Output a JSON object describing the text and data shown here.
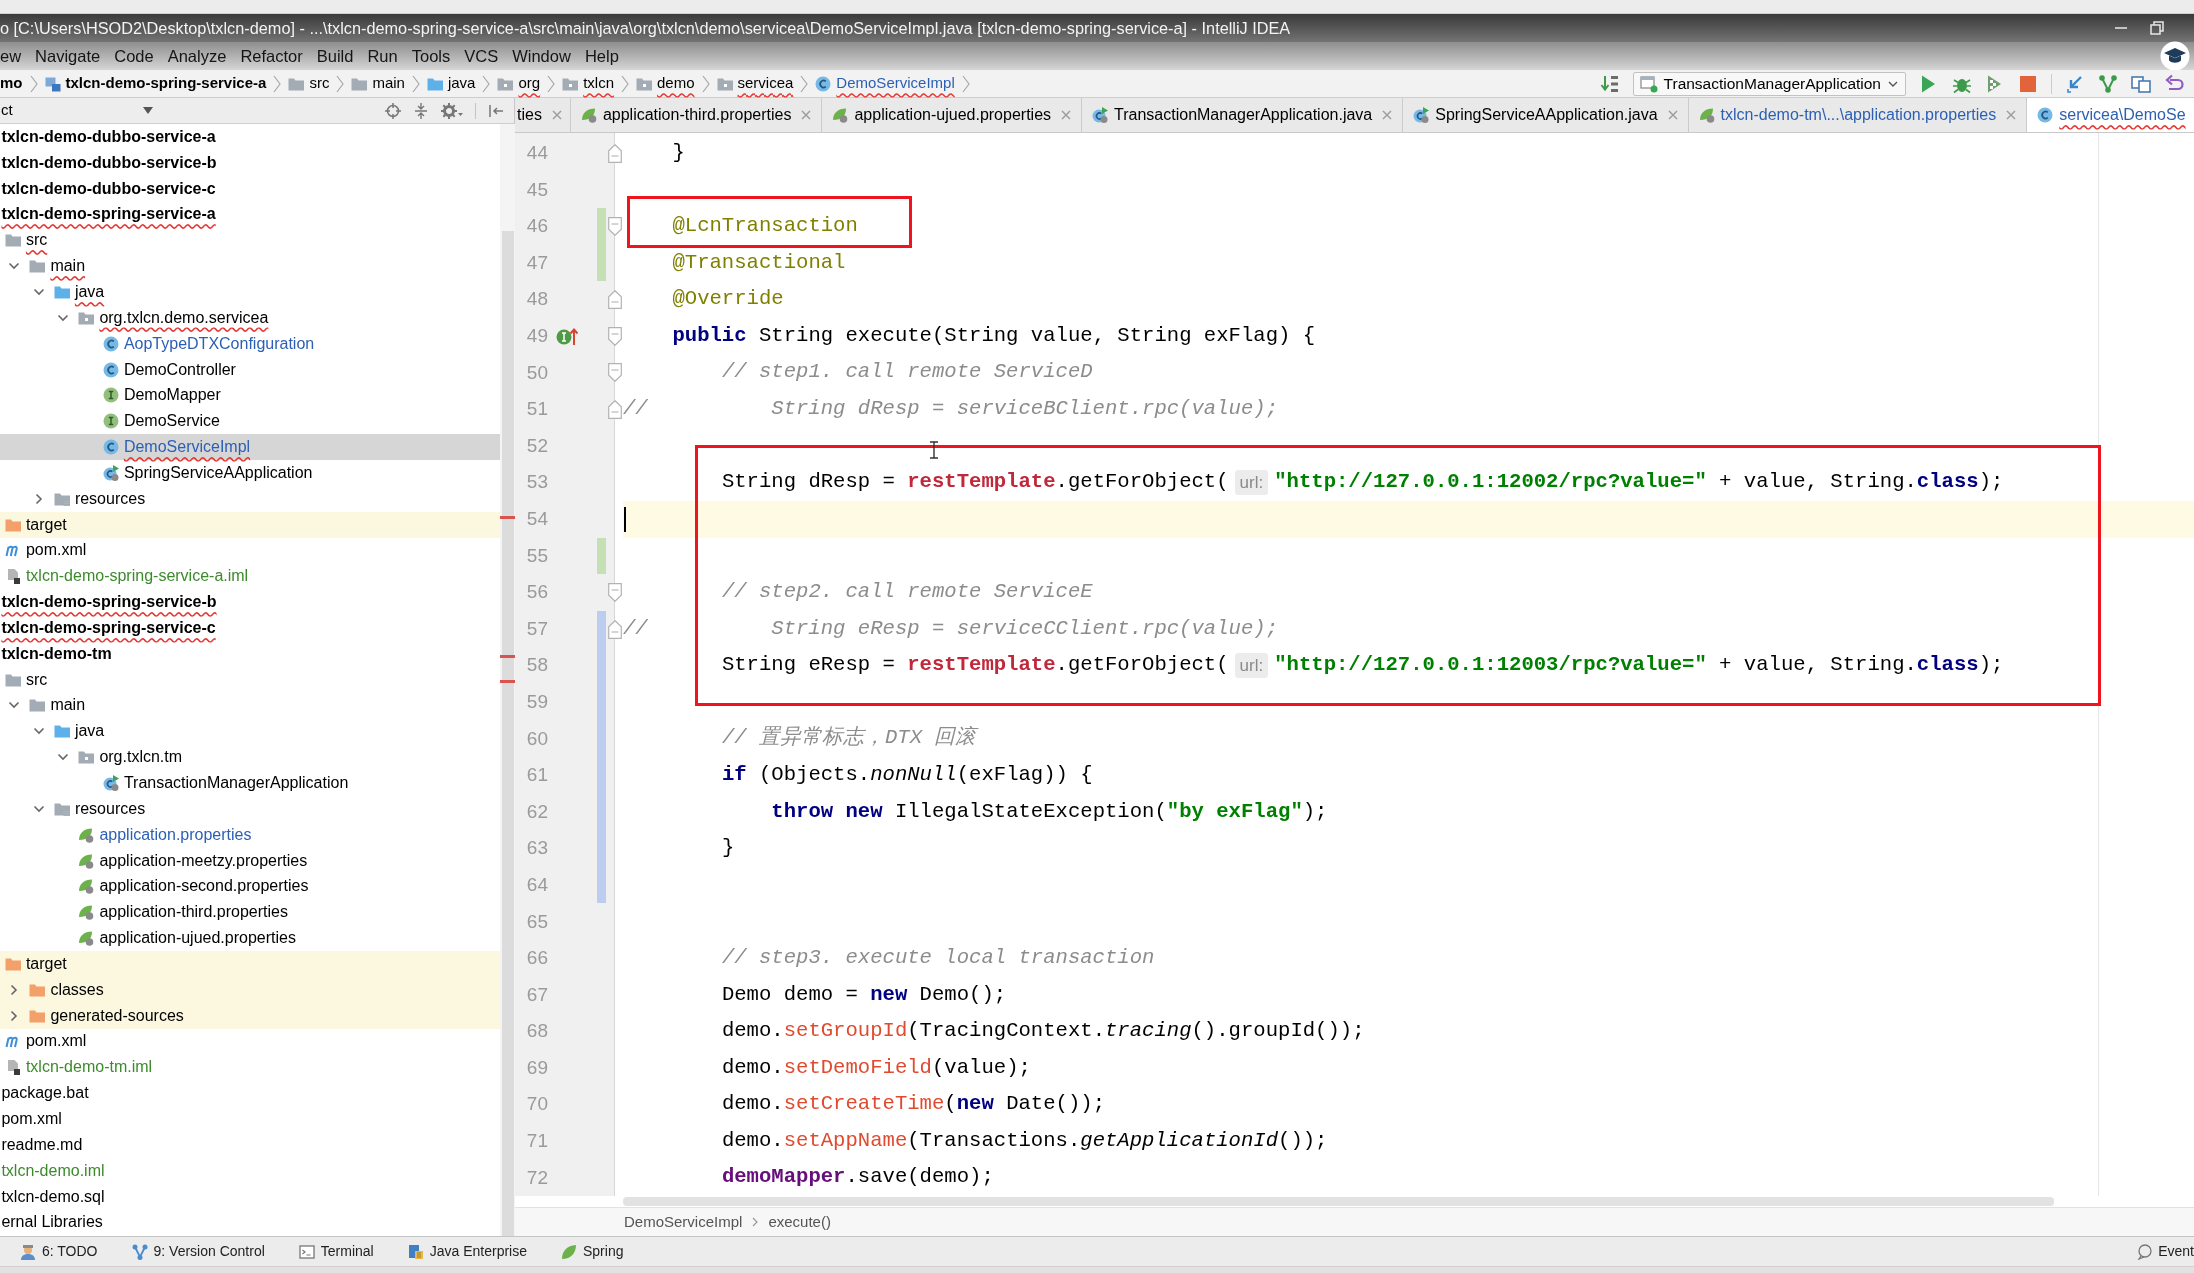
{
  "window": {
    "title": "o [C:\\Users\\HSOD2\\Desktop\\txlcn-demo] - ...\\txlcn-demo-spring-service-a\\src\\main\\java\\org\\txlcn\\demo\\servicea\\DemoServiceImpl.java [txlcn-demo-spring-service-a] - IntelliJ IDEA"
  },
  "menu": [
    "ew",
    "Navigate",
    "Code",
    "Analyze",
    "Refactor",
    "Build",
    "Run",
    "Tools",
    "VCS",
    "Window",
    "Help"
  ],
  "navigation": {
    "crumbs": [
      {
        "label": "mo",
        "kind": "project",
        "errors": false,
        "color": "#000000"
      },
      {
        "label": "txlcn-demo-spring-service-a",
        "kind": "module",
        "errors": false,
        "color": "#000000"
      },
      {
        "label": "src",
        "kind": "folder",
        "errors": false,
        "color": "#000000"
      },
      {
        "label": "main",
        "kind": "folder",
        "errors": false,
        "color": "#000000"
      },
      {
        "label": "java",
        "kind": "source-root",
        "errors": false,
        "color": "#000000"
      },
      {
        "label": "org",
        "kind": "package",
        "errors": true,
        "color": "#000000"
      },
      {
        "label": "txlcn",
        "kind": "package",
        "errors": true,
        "color": "#000000"
      },
      {
        "label": "demo",
        "kind": "package",
        "errors": true,
        "color": "#000000"
      },
      {
        "label": "servicea",
        "kind": "package",
        "errors": true,
        "color": "#000000"
      },
      {
        "label": "DemoServiceImpl",
        "kind": "class",
        "errors": true,
        "color": "#2c5fb3"
      }
    ],
    "run_configuration": {
      "label": "TransactionManagerApplication"
    }
  },
  "project_panel": {
    "title": "ct",
    "tree": [
      {
        "label": "txlcn-demo-dubbo-service-a",
        "kind": "module",
        "selected": false,
        "errors": false,
        "color": "#000000"
      },
      {
        "label": "txlcn-demo-dubbo-service-b",
        "kind": "module",
        "selected": false,
        "errors": false,
        "color": "#000000"
      },
      {
        "label": "txlcn-demo-dubbo-service-c",
        "kind": "module",
        "selected": false,
        "errors": false,
        "color": "#000000"
      },
      {
        "label": "txlcn-demo-spring-service-a",
        "kind": "module",
        "selected": false,
        "errors": true,
        "color": "#000000",
        "children": [
          {
            "label": "src",
            "kind": "folder",
            "selected": false,
            "errors": true,
            "color": "#000000",
            "children": [
              {
                "label": "main",
                "kind": "folder",
                "expanded": true,
                "selected": false,
                "errors": true,
                "color": "#000000",
                "children": [
                  {
                    "label": "java",
                    "kind": "source-root",
                    "expanded": true,
                    "selected": false,
                    "errors": true,
                    "color": "#000000",
                    "children": [
                      {
                        "label": "org.txlcn.demo.servicea",
                        "kind": "package",
                        "expanded": true,
                        "selected": false,
                        "errors": true,
                        "color": "#000000",
                        "children": [
                          {
                            "label": "AopTypeDTXConfiguration",
                            "kind": "class",
                            "selected": false,
                            "errors": false,
                            "color": "#2c5fb3"
                          },
                          {
                            "label": "DemoController",
                            "kind": "class",
                            "selected": false,
                            "errors": false,
                            "color": "#000000"
                          },
                          {
                            "label": "DemoMapper",
                            "kind": "interface",
                            "selected": false,
                            "errors": false,
                            "color": "#000000"
                          },
                          {
                            "label": "DemoService",
                            "kind": "interface",
                            "selected": false,
                            "errors": false,
                            "color": "#000000"
                          },
                          {
                            "label": "DemoServiceImpl",
                            "kind": "class",
                            "selected": true,
                            "errors": true,
                            "color": "#2c5fb3"
                          },
                          {
                            "label": "SpringServiceAApplication",
                            "kind": "boot-app",
                            "selected": false,
                            "errors": false,
                            "color": "#000000"
                          }
                        ]
                      }
                    ]
                  },
                  {
                    "label": "resources",
                    "kind": "resources-root",
                    "expanded": false,
                    "selected": false,
                    "errors": false,
                    "color": "#000000"
                  }
                ]
              }
            ]
          },
          {
            "label": "target",
            "kind": "excluded-folder",
            "selected": false,
            "errors": false,
            "color": "#000000"
          },
          {
            "label": "pom.xml",
            "kind": "maven-pom",
            "selected": false,
            "errors": false,
            "color": "#000000"
          },
          {
            "label": "txlcn-demo-spring-service-a.iml",
            "kind": "module-file",
            "selected": false,
            "errors": false,
            "color": "#3b8b2b"
          }
        ]
      },
      {
        "label": "txlcn-demo-spring-service-b",
        "kind": "module",
        "selected": false,
        "errors": true,
        "color": "#000000"
      },
      {
        "label": "txlcn-demo-spring-service-c",
        "kind": "module",
        "selected": false,
        "errors": true,
        "color": "#000000"
      },
      {
        "label": "txlcn-demo-tm",
        "kind": "module",
        "selected": false,
        "errors": false,
        "color": "#000000",
        "children": [
          {
            "label": "src",
            "kind": "folder",
            "selected": false,
            "errors": false,
            "color": "#000000",
            "children": [
              {
                "label": "main",
                "kind": "folder",
                "expanded": true,
                "selected": false,
                "errors": false,
                "color": "#000000",
                "children": [
                  {
                    "label": "java",
                    "kind": "source-root",
                    "expanded": true,
                    "selected": false,
                    "errors": false,
                    "color": "#000000",
                    "children": [
                      {
                        "label": "org.txlcn.tm",
                        "kind": "package",
                        "expanded": true,
                        "selected": false,
                        "errors": false,
                        "color": "#000000",
                        "children": [
                          {
                            "label": "TransactionManagerApplication",
                            "kind": "boot-app",
                            "selected": false,
                            "errors": false,
                            "color": "#000000"
                          }
                        ]
                      }
                    ]
                  },
                  {
                    "label": "resources",
                    "kind": "resources-root",
                    "expanded": true,
                    "selected": false,
                    "errors": false,
                    "color": "#000000",
                    "children": [
                      {
                        "label": "application.properties",
                        "kind": "properties",
                        "selected": false,
                        "errors": false,
                        "color": "#2c5fb3"
                      },
                      {
                        "label": "application-meetzy.properties",
                        "kind": "properties",
                        "selected": false,
                        "errors": false,
                        "color": "#000000"
                      },
                      {
                        "label": "application-second.properties",
                        "kind": "properties",
                        "selected": false,
                        "errors": false,
                        "color": "#000000"
                      },
                      {
                        "label": "application-third.properties",
                        "kind": "properties",
                        "selected": false,
                        "errors": false,
                        "color": "#000000"
                      },
                      {
                        "label": "application-ujued.properties",
                        "kind": "properties",
                        "selected": false,
                        "errors": false,
                        "color": "#000000"
                      }
                    ]
                  }
                ]
              }
            ]
          },
          {
            "label": "target",
            "kind": "excluded-folder",
            "selected": false,
            "errors": false,
            "color": "#000000",
            "children": [
              {
                "label": "classes",
                "kind": "excluded-folder",
                "expanded": false,
                "selected": false,
                "errors": false,
                "color": "#000000"
              },
              {
                "label": "generated-sources",
                "kind": "excluded-folder",
                "expanded": false,
                "selected": false,
                "errors": false,
                "color": "#000000"
              }
            ]
          },
          {
            "label": "pom.xml",
            "kind": "maven-pom",
            "selected": false,
            "errors": false,
            "color": "#000000"
          },
          {
            "label": "txlcn-demo-tm.iml",
            "kind": "module-file",
            "selected": false,
            "errors": false,
            "color": "#3b8b2b"
          }
        ]
      },
      {
        "label": "package.bat",
        "kind": "file",
        "selected": false,
        "errors": false,
        "color": "#000000"
      },
      {
        "label": "pom.xml",
        "kind": "file",
        "selected": false,
        "errors": false,
        "color": "#000000"
      },
      {
        "label": "readme.md",
        "kind": "file",
        "selected": false,
        "errors": false,
        "color": "#000000"
      },
      {
        "label": "txlcn-demo.iml",
        "kind": "file",
        "selected": false,
        "errors": false,
        "color": "#3b8b2b"
      },
      {
        "label": "txlcn-demo.sql",
        "kind": "file",
        "selected": false,
        "errors": false,
        "color": "#000000"
      },
      {
        "label": "ernal Libraries",
        "kind": "file",
        "selected": false,
        "errors": false,
        "color": "#000000"
      }
    ]
  },
  "editor": {
    "tabs": [
      {
        "label": "ties",
        "kind": "clipped",
        "selected": false,
        "errors": false,
        "color": "#000000",
        "closable": true
      },
      {
        "label": "application-third.properties",
        "kind": "properties",
        "selected": false,
        "errors": false,
        "color": "#000000",
        "closable": true
      },
      {
        "label": "application-ujued.properties",
        "kind": "properties",
        "selected": false,
        "errors": false,
        "color": "#000000",
        "closable": true
      },
      {
        "label": "TransactionManagerApplication.java",
        "kind": "boot-app",
        "selected": false,
        "errors": false,
        "color": "#000000",
        "closable": true
      },
      {
        "label": "SpringServiceAApplication.java",
        "kind": "boot-app",
        "selected": false,
        "errors": false,
        "color": "#000000",
        "closable": true
      },
      {
        "label": "txlcn-demo-tm\\...\\application.properties",
        "kind": "properties",
        "selected": false,
        "errors": false,
        "color": "#2c5fb3",
        "closable": true
      },
      {
        "label": "servicea\\DemoSe",
        "kind": "class",
        "selected": true,
        "errors": true,
        "color": "#2c5fb3"
      }
    ],
    "lines": [
      {
        "number": "44",
        "fold_end": true,
        "tokens": [
          {
            "kind": "plain",
            "text": "    }"
          }
        ]
      },
      {
        "number": "45"
      },
      {
        "number": "46",
        "added": true,
        "fold_start": true,
        "tokens": [
          {
            "kind": "annotation",
            "text": "    @LcnTransaction"
          }
        ]
      },
      {
        "number": "47",
        "added": true,
        "tokens": [
          {
            "kind": "annotation",
            "text": "    @Transactional"
          }
        ]
      },
      {
        "number": "48",
        "fold_end": true,
        "tokens": [
          {
            "kind": "annotation",
            "text": "    @Override"
          }
        ]
      },
      {
        "number": "49",
        "fold_start": true,
        "implements": true,
        "tokens": [
          {
            "kind": "keyword",
            "text": "    public"
          },
          {
            "kind": "plain",
            "text": " String execute(String value, String exFlag) {"
          }
        ]
      },
      {
        "number": "50",
        "fold_start": true,
        "tokens": [
          {
            "kind": "comment",
            "text": "        // step1. call remote ServiceD"
          }
        ]
      },
      {
        "number": "51",
        "fold_end": true,
        "tokens": [
          {
            "kind": "comment",
            "text": "//          String dResp = serviceBClient.rpc(value);"
          }
        ]
      },
      {
        "number": "52"
      },
      {
        "number": "53",
        "tokens": [
          {
            "kind": "plain",
            "text": "        String dResp = "
          },
          {
            "kind": "unresolved-field",
            "text": "restTemplate"
          },
          {
            "kind": "plain",
            "text": ".getForObject("
          },
          {
            "kind": "hint",
            "text": "url:"
          },
          {
            "kind": "string",
            "text": "\"http://127.0.0.1:12002/rpc?value=\""
          },
          {
            "kind": "plain",
            "text": " + value, String."
          },
          {
            "kind": "keyword",
            "text": "class"
          },
          {
            "kind": "plain",
            "text": ");"
          }
        ]
      },
      {
        "number": "54",
        "current": true
      },
      {
        "number": "55",
        "added": true
      },
      {
        "number": "56",
        "fold_start": true,
        "tokens": [
          {
            "kind": "comment",
            "text": "        // step2. call remote ServiceE"
          }
        ]
      },
      {
        "number": "57",
        "modified": true,
        "fold_end": true,
        "tokens": [
          {
            "kind": "comment",
            "text": "//          String eResp = serviceCClient.rpc(value);"
          }
        ]
      },
      {
        "number": "58",
        "modified": true,
        "tokens": [
          {
            "kind": "plain",
            "text": "        String eResp = "
          },
          {
            "kind": "unresolved-field",
            "text": "restTemplate"
          },
          {
            "kind": "plain",
            "text": ".getForObject("
          },
          {
            "kind": "hint",
            "text": "url:"
          },
          {
            "kind": "string",
            "text": "\"http://127.0.0.1:12003/rpc?value=\""
          },
          {
            "kind": "plain",
            "text": " + value, String."
          },
          {
            "kind": "keyword",
            "text": "class"
          },
          {
            "kind": "plain",
            "text": ");"
          }
        ]
      },
      {
        "number": "59",
        "modified": true
      },
      {
        "number": "60",
        "modified": true,
        "tokens": [
          {
            "kind": "comment",
            "text": "        // 置异常标志，DTX 回滚"
          }
        ]
      },
      {
        "number": "61",
        "modified": true,
        "tokens": [
          {
            "kind": "keyword",
            "text": "        if"
          },
          {
            "kind": "plain",
            "text": " (Objects."
          },
          {
            "kind": "static-call",
            "text": "nonNull"
          },
          {
            "kind": "plain",
            "text": "(exFlag)) {"
          }
        ]
      },
      {
        "number": "62",
        "modified": true,
        "tokens": [
          {
            "kind": "keyword",
            "text": "            throw new"
          },
          {
            "kind": "plain",
            "text": " IllegalStateException("
          },
          {
            "kind": "string",
            "text": "\"by exFlag\""
          },
          {
            "kind": "plain",
            "text": ");"
          }
        ]
      },
      {
        "number": "63",
        "modified": true,
        "tokens": [
          {
            "kind": "plain",
            "text": "        }"
          }
        ]
      },
      {
        "number": "64",
        "modified": true
      },
      {
        "number": "65"
      },
      {
        "number": "66",
        "tokens": [
          {
            "kind": "comment",
            "text": "        // step3. execute local transaction"
          }
        ]
      },
      {
        "number": "67",
        "tokens": [
          {
            "kind": "plain",
            "text": "        Demo demo = "
          },
          {
            "kind": "keyword",
            "text": "new"
          },
          {
            "kind": "plain",
            "text": " Demo();"
          }
        ]
      },
      {
        "number": "68",
        "tokens": [
          {
            "kind": "plain",
            "text": "        demo."
          },
          {
            "kind": "unresolved-call",
            "text": "setGroupId"
          },
          {
            "kind": "plain",
            "text": "(TracingContext."
          },
          {
            "kind": "static-call",
            "text": "tracing"
          },
          {
            "kind": "plain",
            "text": "().groupId());"
          }
        ]
      },
      {
        "number": "69",
        "tokens": [
          {
            "kind": "plain",
            "text": "        demo."
          },
          {
            "kind": "unresolved-call",
            "text": "setDemoField"
          },
          {
            "kind": "plain",
            "text": "(value);"
          }
        ]
      },
      {
        "number": "70",
        "tokens": [
          {
            "kind": "plain",
            "text": "        demo."
          },
          {
            "kind": "unresolved-call",
            "text": "setCreateTime"
          },
          {
            "kind": "plain",
            "text": "("
          },
          {
            "kind": "keyword",
            "text": "new"
          },
          {
            "kind": "plain",
            "text": " Date());"
          }
        ]
      },
      {
        "number": "71",
        "tokens": [
          {
            "kind": "plain",
            "text": "        demo."
          },
          {
            "kind": "unresolved-call",
            "text": "setAppName"
          },
          {
            "kind": "plain",
            "text": "(Transactions."
          },
          {
            "kind": "static-call",
            "text": "getApplicationId"
          },
          {
            "kind": "plain",
            "text": "());"
          }
        ]
      },
      {
        "number": "72",
        "tokens": [
          {
            "kind": "field",
            "text": "        demoMapper"
          },
          {
            "kind": "plain",
            "text": ".save(demo);"
          }
        ]
      }
    ],
    "breadcrumbs": [
      "DemoServiceImpl",
      "execute()"
    ]
  },
  "tool_windows": [
    {
      "label": "6: TODO",
      "kind": "todo"
    },
    {
      "label": "9: Version Control",
      "kind": "vcs"
    },
    {
      "label": "Terminal",
      "kind": "terminal"
    },
    {
      "label": "Java Enterprise",
      "kind": "java-enterprise"
    },
    {
      "label": "Spring",
      "kind": "spring"
    }
  ],
  "event_log": {
    "label": "Event"
  }
}
